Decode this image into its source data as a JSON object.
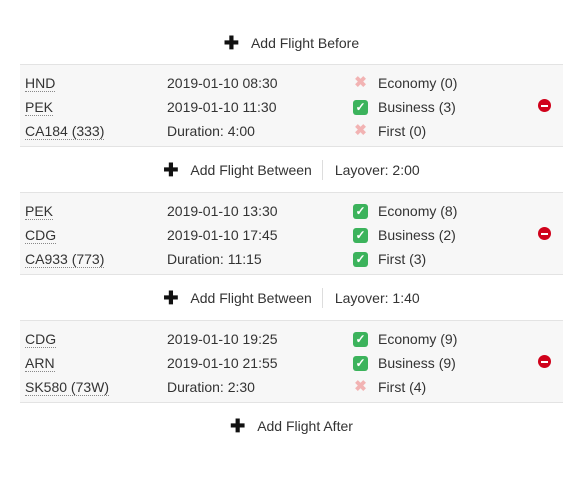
{
  "add_before": "Add Flight Before",
  "add_after": "Add Flight After",
  "add_between": "Add Flight Between",
  "flights": [
    {
      "from": "HND",
      "to": "PEK",
      "flight": "CA184 (333)",
      "depart": "2019-01-10 08:30",
      "arrive": "2019-01-10 11:30",
      "duration": "Duration: 4:00",
      "classes": [
        {
          "label": "Economy (0)",
          "available": false
        },
        {
          "label": "Business (3)",
          "available": true
        },
        {
          "label": "First (0)",
          "available": false
        }
      ]
    },
    {
      "from": "PEK",
      "to": "CDG",
      "flight": "CA933 (773)",
      "depart": "2019-01-10 13:30",
      "arrive": "2019-01-10 17:45",
      "duration": "Duration: 11:15",
      "classes": [
        {
          "label": "Economy (8)",
          "available": true
        },
        {
          "label": "Business (2)",
          "available": true
        },
        {
          "label": "First (3)",
          "available": true
        }
      ]
    },
    {
      "from": "CDG",
      "to": "ARN",
      "flight": "SK580 (73W)",
      "depart": "2019-01-10 19:25",
      "arrive": "2019-01-10 21:55",
      "duration": "Duration: 2:30",
      "classes": [
        {
          "label": "Economy (9)",
          "available": true
        },
        {
          "label": "Business (9)",
          "available": true
        },
        {
          "label": "First (4)",
          "available": false
        }
      ]
    }
  ],
  "layovers": [
    "Layover: 2:00",
    "Layover: 1:40"
  ],
  "icons": {
    "plus": "plus-icon",
    "check": "check-icon",
    "cross": "cross-icon",
    "remove": "remove-icon"
  },
  "colors": {
    "check": "#3cb35c",
    "cross": "#f2b3b3",
    "remove": "#d0021b",
    "block_bg": "#f7f7f7"
  }
}
